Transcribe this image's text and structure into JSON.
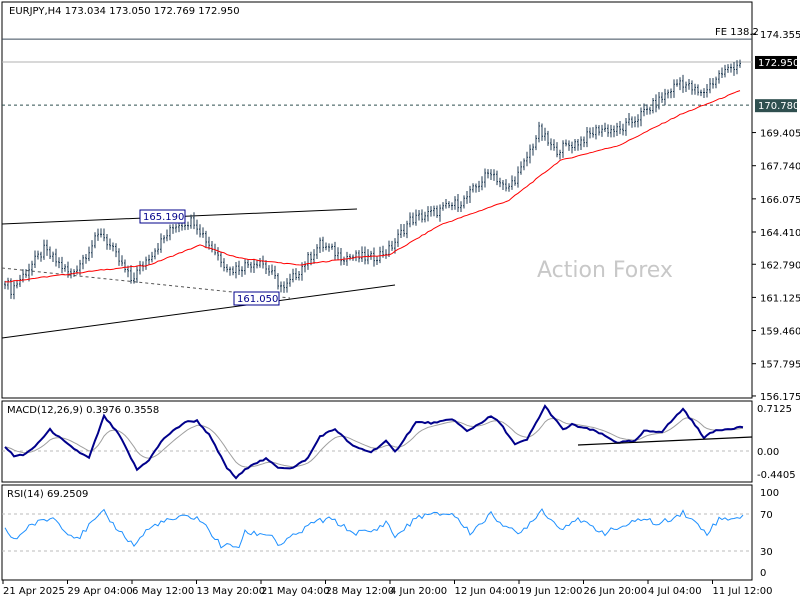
{
  "header": {
    "symbol_info": "EURJPY,H4  173.034 173.050 172.769 172.950"
  },
  "watermark": "Action Forex",
  "colors": {
    "bars": "#1f3a52",
    "ma": "#ff0000",
    "macd": "#00008b",
    "signal": "#a0a0a0",
    "rsi": "#1e90ff",
    "current_price_bg": "#000000",
    "level_bg": "#2f4f4f"
  },
  "chart_data": [
    {
      "type": "line",
      "title": "EURJPY,H4",
      "x_unit": "bar index",
      "ylim": [
        156.175,
        174.355
      ],
      "yticks": [
        "174.355",
        "169.405",
        "167.740",
        "166.075",
        "164.410",
        "162.790",
        "161.125",
        "159.460",
        "157.795",
        "156.175"
      ],
      "xticks": [
        "21 Apr 2025",
        "29 Apr 04:00",
        "6 May 12:00",
        "13 May 20:00",
        "21 May 04:00",
        "28 May 12:00",
        "4 Jun 20:00",
        "12 Jun 04:00",
        "19 Jun 12:00",
        "26 Jun 20:00",
        "4 Jul 04:00",
        "11 Jul 12:00"
      ],
      "price_path": [
        [
          0,
          162.0
        ],
        [
          2,
          161.5
        ],
        [
          13,
          163.5
        ],
        [
          22,
          162.25
        ],
        [
          32,
          164.4
        ],
        [
          42,
          162.0
        ],
        [
          48,
          163.2
        ],
        [
          57,
          164.8
        ],
        [
          63,
          165.0
        ],
        [
          68,
          163.8
        ],
        [
          75,
          162.5
        ],
        [
          85,
          163.0
        ],
        [
          93,
          161.5
        ],
        [
          98,
          162.5
        ],
        [
          105,
          163.8
        ],
        [
          112,
          163.2
        ],
        [
          122,
          163.1
        ],
        [
          128,
          163.5
        ],
        [
          135,
          165.0
        ],
        [
          145,
          165.5
        ],
        [
          153,
          166.0
        ],
        [
          162,
          167.5
        ],
        [
          167,
          166.5
        ],
        [
          172,
          167.5
        ],
        [
          178,
          169.5
        ],
        [
          183,
          168.5
        ],
        [
          192,
          169.0
        ],
        [
          198,
          169.6
        ],
        [
          205,
          169.5
        ],
        [
          212,
          170.3
        ],
        [
          218,
          171.0
        ],
        [
          225,
          172.0
        ],
        [
          232,
          171.3
        ],
        [
          238,
          172.3
        ],
        [
          245,
          172.95
        ]
      ],
      "ma_path": [
        [
          0,
          161.9
        ],
        [
          32,
          162.5
        ],
        [
          48,
          162.75
        ],
        [
          65,
          163.75
        ],
        [
          78,
          163.1
        ],
        [
          98,
          162.75
        ],
        [
          118,
          163.15
        ],
        [
          128,
          163.25
        ],
        [
          145,
          164.76
        ],
        [
          168,
          166.0
        ],
        [
          185,
          168.0
        ],
        [
          205,
          168.78
        ],
        [
          225,
          170.3
        ],
        [
          245,
          171.5
        ]
      ],
      "current_price": "172.950",
      "level": "170.780",
      "fe_label": "FE 138.2",
      "fe_price": 174.1,
      "annotations": [
        "165.190",
        "161.050"
      ]
    },
    {
      "type": "line",
      "title": "MACD(12,26,9) 0.3976 0.3558",
      "ylim": [
        -0.4405,
        0.7125
      ],
      "yticks": [
        "0.7125",
        "0.00",
        "-0.4405"
      ],
      "macd_path": [
        [
          0,
          0.078
        ],
        [
          3,
          -0.088
        ],
        [
          6,
          -0.061
        ],
        [
          9,
          0.022
        ],
        [
          15,
          0.353
        ],
        [
          21,
          0.105
        ],
        [
          26,
          -0.061
        ],
        [
          28,
          -0.116
        ],
        [
          33,
          0.575
        ],
        [
          38,
          0.27
        ],
        [
          44,
          -0.31
        ],
        [
          48,
          -0.144
        ],
        [
          53,
          0.215
        ],
        [
          60,
          0.48
        ],
        [
          64,
          0.502
        ],
        [
          68,
          0.27
        ],
        [
          74,
          -0.282
        ],
        [
          77,
          -0.447
        ],
        [
          82,
          -0.227
        ],
        [
          87,
          -0.133
        ],
        [
          91,
          -0.27
        ],
        [
          96,
          -0.282
        ],
        [
          101,
          -0.116
        ],
        [
          105,
          0.243
        ],
        [
          110,
          0.365
        ],
        [
          116,
          0.078
        ],
        [
          122,
          -0.017
        ],
        [
          127,
          0.16
        ],
        [
          130,
          -0.017
        ],
        [
          137,
          0.475
        ],
        [
          144,
          0.464
        ],
        [
          149,
          0.536
        ],
        [
          154,
          0.326
        ],
        [
          162,
          0.575
        ],
        [
          165,
          0.464
        ],
        [
          170,
          0.105
        ],
        [
          174,
          0.188
        ],
        [
          180,
          0.74
        ],
        [
          186,
          0.353
        ],
        [
          189,
          0.436
        ],
        [
          197,
          0.326
        ],
        [
          204,
          0.144
        ],
        [
          210,
          0.16
        ],
        [
          213,
          0.326
        ],
        [
          219,
          0.326
        ],
        [
          226,
          0.7
        ],
        [
          233,
          0.227
        ],
        [
          237,
          0.343
        ],
        [
          246,
          0.4
        ]
      ]
    },
    {
      "type": "line",
      "title": "RSI(14) 69.2509",
      "ylim": [
        0,
        100
      ],
      "yticks": [
        "100",
        "70",
        "30",
        "0"
      ],
      "rsi_path": [
        [
          0,
          54
        ],
        [
          3,
          39
        ],
        [
          8,
          58
        ],
        [
          16,
          68
        ],
        [
          22,
          46
        ],
        [
          25,
          44
        ],
        [
          28,
          58
        ],
        [
          33,
          74.5
        ],
        [
          36,
          60
        ],
        [
          43,
          33
        ],
        [
          47,
          51
        ],
        [
          51,
          61
        ],
        [
          60,
          69
        ],
        [
          64,
          68
        ],
        [
          66,
          61
        ],
        [
          72,
          33
        ],
        [
          78,
          32
        ],
        [
          80,
          49
        ],
        [
          89,
          47
        ],
        [
          91,
          33
        ],
        [
          99,
          51
        ],
        [
          103,
          63
        ],
        [
          109,
          66
        ],
        [
          116,
          49
        ],
        [
          123,
          51
        ],
        [
          127,
          63
        ],
        [
          130,
          44
        ],
        [
          138,
          70
        ],
        [
          149,
          73.5
        ],
        [
          155,
          49
        ],
        [
          162,
          72
        ],
        [
          171,
          46
        ],
        [
          179,
          78
        ],
        [
          185,
          54
        ],
        [
          190,
          66
        ],
        [
          200,
          49
        ],
        [
          214,
          68
        ],
        [
          217,
          58
        ],
        [
          226,
          74.5
        ],
        [
          234,
          49
        ],
        [
          238,
          66
        ],
        [
          246,
          69.25
        ]
      ]
    }
  ]
}
